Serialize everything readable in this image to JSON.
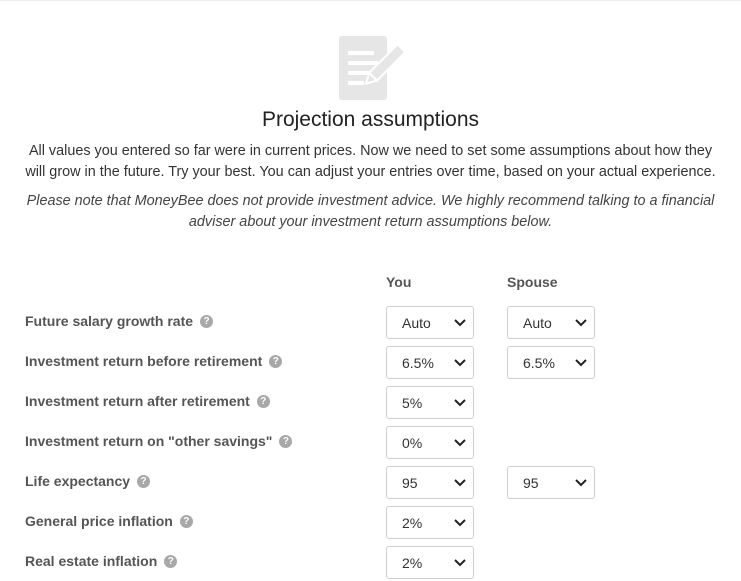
{
  "header": {
    "icon": "document-edit-icon",
    "title": "Projection assumptions",
    "intro": "All values you entered so far were in current prices. Now we need to set some assumptions about how they will grow in the future. Try your best. You can adjust your entries over time, based on your actual experience.",
    "disclaimer": "Please note that MoneyBee does not provide investment advice. We highly recommend talking to a financial adviser about your investment return assumptions below."
  },
  "columns": {
    "you": "You",
    "spouse": "Spouse"
  },
  "help_glyph": "?",
  "rows": [
    {
      "label": "Future salary growth rate",
      "you": "Auto",
      "spouse": "Auto"
    },
    {
      "label": "Investment return before retirement",
      "you": "6.5%",
      "spouse": "6.5%"
    },
    {
      "label": "Investment return after retirement",
      "you": "5%"
    },
    {
      "label": "Investment return on \"other savings\"",
      "you": "0%"
    },
    {
      "label": "Life expectancy",
      "you": "95",
      "spouse": "95"
    },
    {
      "label": "General price inflation",
      "you": "2%"
    },
    {
      "label": "Real estate inflation",
      "you": "2%"
    }
  ]
}
